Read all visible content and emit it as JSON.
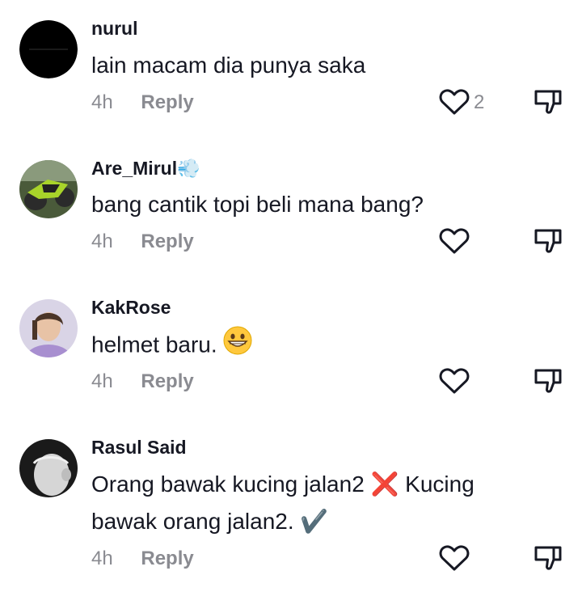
{
  "comments": [
    {
      "username": "nurul",
      "username_suffix": "",
      "text": "lain macam dia punya saka",
      "text_line2": "",
      "time": "4h",
      "reply_label": "Reply",
      "like_count": "2",
      "avatar_icon": "black-avatar"
    },
    {
      "username": "Are_Mirul",
      "username_suffix": "💨",
      "text": "bang cantik topi beli mana bang?",
      "text_line2": "",
      "time": "4h",
      "reply_label": "Reply",
      "like_count": "",
      "avatar_icon": "motorcycle-avatar"
    },
    {
      "username": "KakRose",
      "username_suffix": "",
      "text": "helmet baru.",
      "text_emoji": "😁",
      "text_line2": "",
      "time": "4h",
      "reply_label": "Reply",
      "like_count": "",
      "avatar_icon": "person-avatar"
    },
    {
      "username": "Rasul Said",
      "username_suffix": "",
      "text": "Orang bawak kucing jalan2 ❌ Kucing",
      "text_line2": "bawak orang jalan2. ✔️",
      "time": "4h",
      "reply_label": "Reply",
      "like_count": "",
      "avatar_icon": "bw-person-avatar"
    }
  ],
  "colors": {
    "text": "#161823",
    "muted": "#8a8b91",
    "icon": "#161823"
  }
}
